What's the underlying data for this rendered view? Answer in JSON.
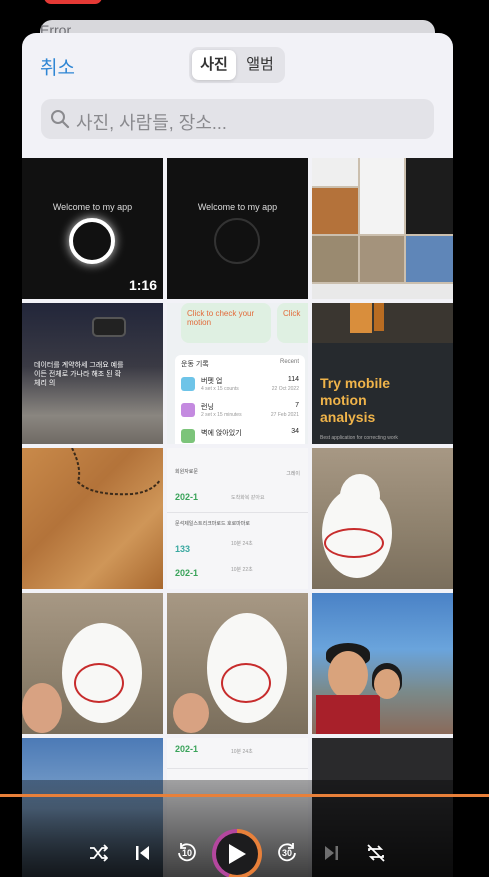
{
  "background": {
    "error_label": "Error"
  },
  "picker": {
    "cancel_label": "취소",
    "tabs": [
      {
        "label": "사진",
        "active": true
      },
      {
        "label": "앨범",
        "active": false
      }
    ],
    "search_placeholder": "사진, 사람들, 장소..."
  },
  "grid": {
    "cells": [
      {
        "type": "video",
        "title": "Welcome to my app",
        "duration": "1:16"
      },
      {
        "type": "image",
        "title": "Welcome to my app"
      },
      {
        "type": "screenshot-collage"
      },
      {
        "type": "image",
        "caption_lines": [
          "데이터를 계약하세 그래요 예를",
          "이든 전체로 가나라 해조 된 확",
          "체리 의"
        ]
      },
      {
        "type": "screenshot",
        "banner_left": "Click to check your motion",
        "banner_right": "Click",
        "panel_header": "운동 기록",
        "panel_recent": "Recent",
        "rows": [
          {
            "name": "버펫 업",
            "sub": "4 set x 15 counts",
            "count": "114",
            "date": "22 Oct 2022"
          },
          {
            "name": "런닝",
            "sub": "2 set x 15 minutes",
            "count": "7",
            "date": "27 Feb 2021"
          },
          {
            "name": "벽에 앉아있기",
            "sub": "",
            "count": "34",
            "date": ""
          }
        ]
      },
      {
        "type": "image",
        "headline_lines": [
          "Try mobile",
          "motion",
          "analysis"
        ],
        "small": "Best application for correcting work"
      },
      {
        "type": "image"
      },
      {
        "type": "screenshot",
        "items": [
          {
            "label": "회원자료문",
            "code": "202-1",
            "code_color": "#3aa35a",
            "note": "도착화복 같아요",
            "chip": "그레이"
          },
          {
            "label": "문석제일스트리크마로드 호로마마로",
            "code": "133",
            "code_color": "#3aa8a0",
            "note": "10분 24초",
            "chip": ""
          },
          {
            "label": "",
            "code": "202-1",
            "code_color": "#3aa35a",
            "note": "10분 22초",
            "chip": ""
          }
        ]
      },
      {
        "type": "image"
      },
      {
        "type": "image"
      },
      {
        "type": "image"
      },
      {
        "type": "image"
      },
      {
        "type": "image"
      },
      {
        "type": "screenshot",
        "code": "202-1",
        "note": "10분 24초"
      },
      {
        "type": "image"
      }
    ]
  },
  "player": {
    "progress": 1.0,
    "skip_back_seconds": "10",
    "skip_forward_seconds": "30",
    "colors": {
      "accent": "#e8803a",
      "accent2": "#b3479e"
    }
  }
}
